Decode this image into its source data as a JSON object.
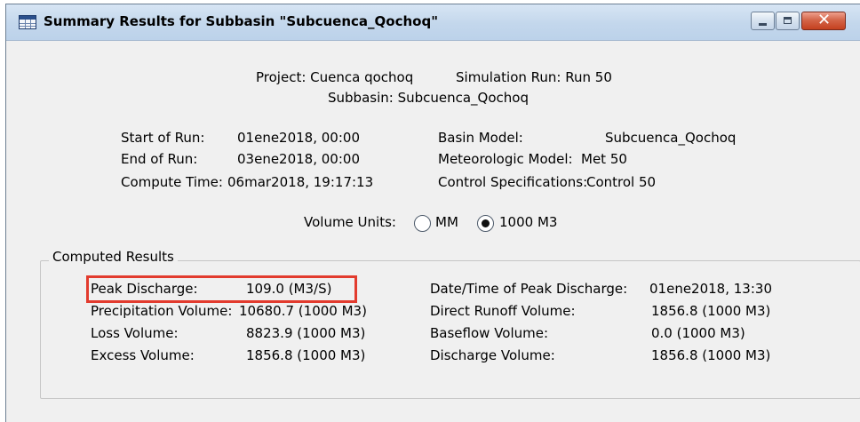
{
  "window": {
    "title": "Summary Results for Subbasin \"Subcuenca_Qochoq\"",
    "icon": "table-grid-icon",
    "buttons": [
      "minimize",
      "maximize",
      "close"
    ]
  },
  "header": {
    "project": "Project: Cuenca qochoq",
    "simulation_run": "Simulation Run: Run 50",
    "subbasin": "Subbasin: Subcuenca_Qochoq"
  },
  "run_info": {
    "start_label": "Start of Run:",
    "start_value": "01ene2018, 00:00",
    "end_label": "End of Run:",
    "end_value": "03ene2018, 00:00",
    "compute_label": "Compute Time:",
    "compute_value": "06mar2018, 19:17:13",
    "basin_label": "Basin Model:",
    "basin_value": "Subcuenca_Qochoq",
    "met_label": "Meteorologic Model:",
    "met_value": "Met 50",
    "control_label": "Control Specifications:",
    "control_value": "Control 50"
  },
  "volume_units": {
    "label": "Volume Units:",
    "options": [
      "MM",
      "1000 M3"
    ],
    "selected": "1000 M3"
  },
  "computed_results": {
    "title": "Computed Results",
    "left": [
      {
        "label": "Peak Discharge:",
        "value": "109.0 (M3/S)"
      },
      {
        "label": "Precipitation Volume:",
        "value": "10680.7 (1000 M3)"
      },
      {
        "label": "Loss Volume:",
        "value": "8823.9 (1000 M3)"
      },
      {
        "label": "Excess Volume:",
        "value": "1856.8 (1000 M3)"
      }
    ],
    "right": [
      {
        "label": "Date/Time of Peak Discharge:",
        "value": "01ene2018, 13:30"
      },
      {
        "label": "Direct Runoff Volume:",
        "value": "1856.8 (1000 M3)"
      },
      {
        "label": "Baseflow Volume:",
        "value": "0.0 (1000 M3)"
      },
      {
        "label": "Discharge Volume:",
        "value": "1856.8 (1000 M3)"
      }
    ],
    "highlight_color": "#e23b2e"
  }
}
